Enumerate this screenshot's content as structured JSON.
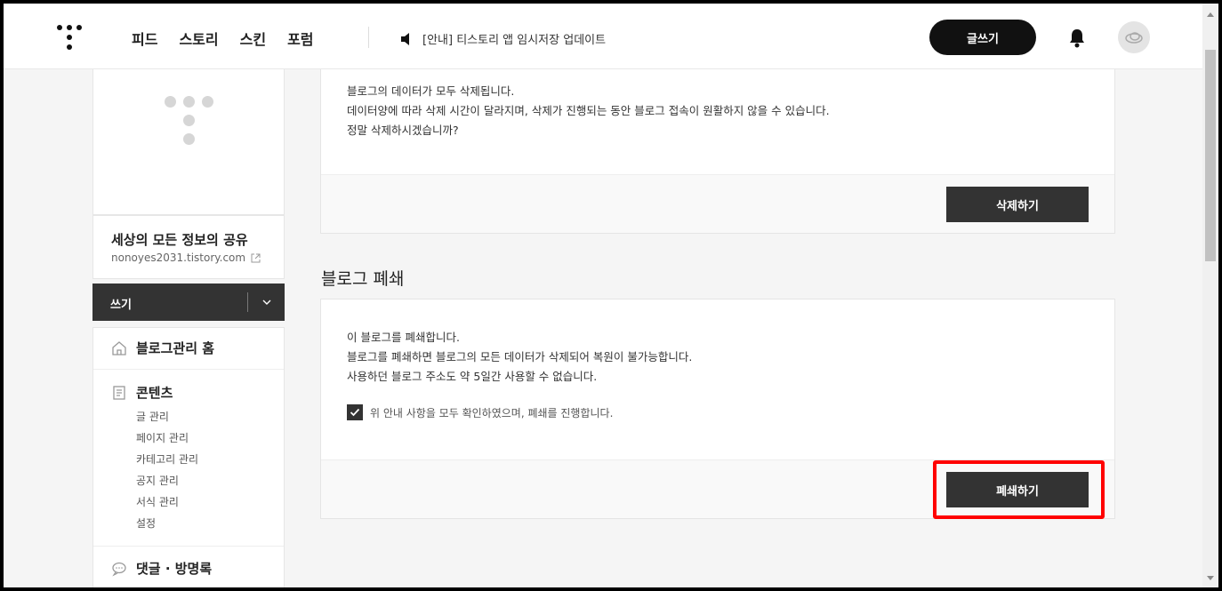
{
  "header": {
    "nav": [
      "피드",
      "스토리",
      "스킨",
      "포럼"
    ],
    "notice": "[안내] 티스토리 앱 임시저장 업데이트",
    "write_label": "글쓰기"
  },
  "sidebar": {
    "blog_title": "세상의 모든 정보의 공유",
    "blog_url": "nonoyes2031.tistory.com",
    "write_label": "쓰기",
    "menu": {
      "home": "블로그관리 홈",
      "contents": "콘텐츠",
      "contents_items": [
        "글 관리",
        "페이지 관리",
        "카테고리 관리",
        "공지 관리",
        "서식 관리",
        "설정"
      ],
      "comments": "댓글 · 방명록"
    }
  },
  "delete_section": {
    "lines": [
      "블로그의 데이터가 모두 삭제됩니다.",
      "데이터양에 따라 삭제 시간이 달라지며, 삭제가 진행되는 동안 블로그 접속이 원활하지 않을 수 있습니다.",
      "정말 삭제하시겠습니까?"
    ],
    "button": "삭제하기"
  },
  "close_section": {
    "title": "블로그 폐쇄",
    "lines": [
      "이 블로그를 폐쇄합니다.",
      "블로그를 폐쇄하면 블로그의 모든 데이터가 삭제되어 복원이 불가능합니다.",
      "사용하던 블로그 주소도 약 5일간 사용할 수 없습니다."
    ],
    "confirm": "위 안내 사항을 모두 확인하였으며, 폐쇄를 진행합니다.",
    "confirm_checked": true,
    "button": "폐쇄하기"
  },
  "colors": {
    "dark": "#333333",
    "highlight": "#ff0000"
  }
}
